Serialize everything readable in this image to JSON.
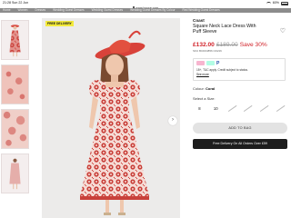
{
  "status": {
    "time": "21:28",
    "date": "Sun 22 Jun",
    "battery": "60%"
  },
  "browser": {
    "url": "www.house.com"
  },
  "breadcrumb": [
    "Home",
    "Women",
    "Dresses",
    "Wedding Guest Dresses",
    "Wedding Guest Dresses",
    "Wedding Guest Dresses By Colour",
    "Red Wedding Guest Dresses"
  ],
  "gallery": {
    "badge": "FREE DELIVERY",
    "next_icon": "chevron-right-icon",
    "thumbnails": 4
  },
  "product": {
    "brand": "Coast",
    "title": "Square Neck Lace Dress With Puff Sleeve",
    "price_now": "£132.00",
    "price_was": "£189.00",
    "price_save": "Save 30%",
    "sku": "SKU BCD04856 CD216",
    "pay_text": "18+, T&C apply. Credit subject to status.",
    "see_more": "See more",
    "paypal_label": "P",
    "colour_label": "Colour:",
    "colour_value": "Coral",
    "size_label": "Select a Size:",
    "sizes": [
      "8",
      "10",
      "",
      "",
      "",
      ""
    ],
    "add_to_bag": "ADD TO BAG",
    "delivery": "Free Delivery On All Orders Over £59"
  },
  "colors": {
    "price_red": "#d1232a",
    "badge_yellow": "#f3ea3c",
    "dress_red": "#c9403a",
    "dress_pink": "#f2c7c0"
  }
}
